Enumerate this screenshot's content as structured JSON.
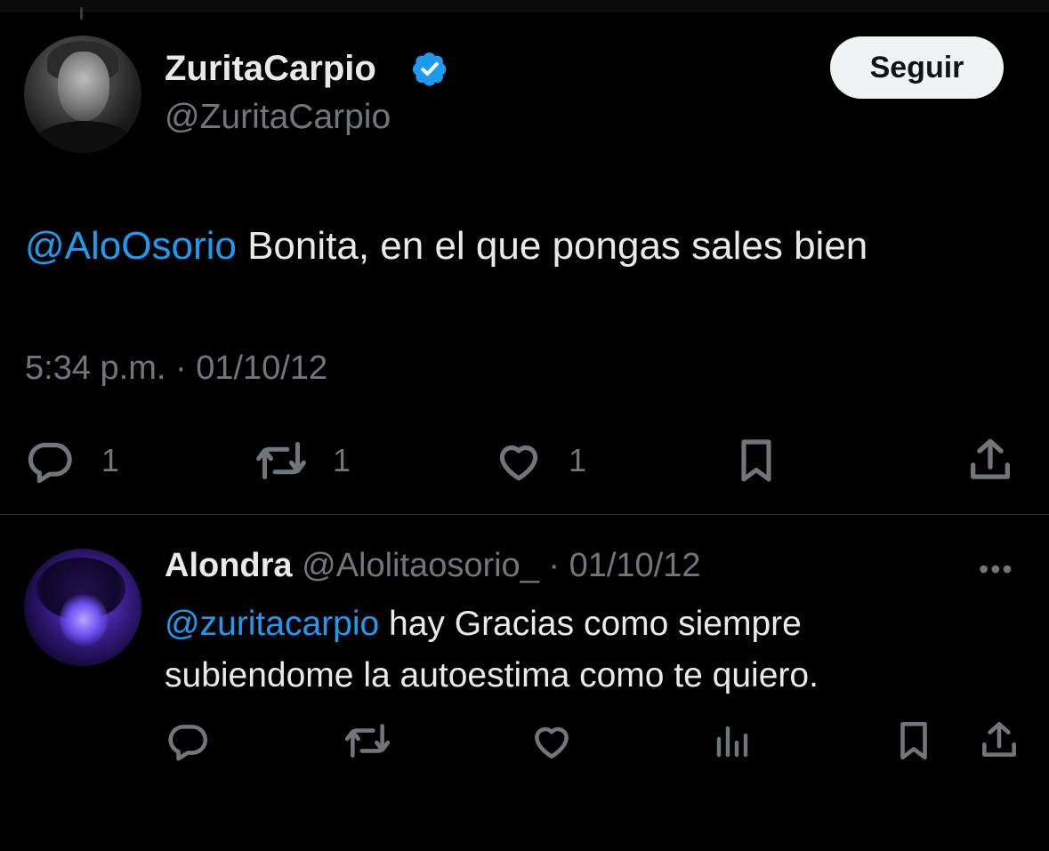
{
  "main_tweet": {
    "display_name": "ZuritaCarpio",
    "handle": "@ZuritaCarpio",
    "follow_label": "Seguir",
    "mention": "@AloOsorio",
    "text": " Bonita, en el que pongas sales bien",
    "timestamp": "5:34 p.m. · 01/10/12",
    "reply_count": "1",
    "retweet_count": "1",
    "like_count": "1",
    "colors": {
      "accent": "#1d9bf0",
      "muted": "#71767b",
      "text": "#e7e9ea",
      "background": "#000000"
    },
    "icons": [
      "verified-badge-icon",
      "reply-icon",
      "retweet-icon",
      "like-icon",
      "bookmark-icon",
      "share-icon"
    ]
  },
  "reply": {
    "display_name": "Alondra",
    "handle_and_date": " @Alolitaosorio_ · 01/10/12",
    "more_label": "•••",
    "mention": "@zuritacarpio",
    "text": " hay Gracias como siempre subiendome la autoestima como te quiero.",
    "icons": [
      "reply-icon",
      "retweet-icon",
      "like-icon",
      "views-icon",
      "bookmark-icon",
      "share-icon"
    ]
  }
}
